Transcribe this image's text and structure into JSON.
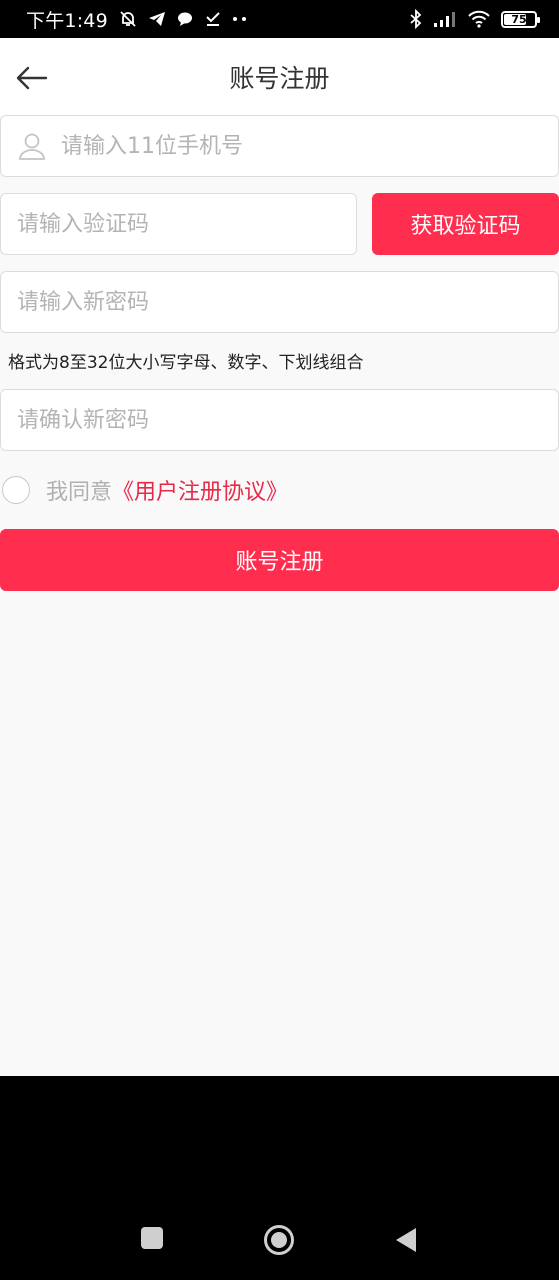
{
  "status_bar": {
    "time": "下午1:49",
    "battery": "75",
    "battery_level": 0.75
  },
  "header": {
    "title": "账号注册"
  },
  "form": {
    "phone_placeholder": "请输入11位手机号",
    "code_placeholder": "请输入验证码",
    "get_code_label": "获取验证码",
    "password_placeholder": "请输入新密码",
    "password_hint": "格式为8至32位大小写字母、数字、下划线组合",
    "confirm_placeholder": "请确认新密码",
    "agree_prefix": "我同意",
    "agree_link": "《用户注册协议》",
    "submit_label": "账号注册"
  },
  "colors": {
    "accent": "#ff2e4f",
    "link": "#e8294a",
    "background": "#f9f9f9"
  },
  "icons": {
    "back": "arrow-left-icon",
    "user": "user-icon",
    "nav_square": "square-icon",
    "nav_home": "circle-icon",
    "nav_back": "triangle-back-icon"
  }
}
